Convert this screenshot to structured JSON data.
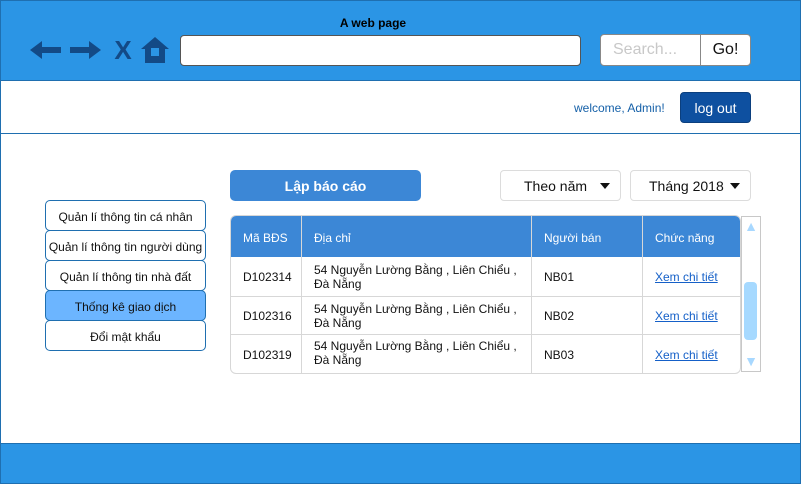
{
  "browser": {
    "title": "A web page",
    "url_value": "",
    "search_placeholder": "Search...",
    "go_label": "Go!",
    "close_label": "X"
  },
  "header": {
    "welcome": "welcome, Admin!",
    "logout_label": "log out"
  },
  "sidebar": {
    "items": [
      {
        "label": "Quản lí thông tin cá nhân"
      },
      {
        "label": "Quản lí thông tin người dùng"
      },
      {
        "label": "Quản lí thông tin nhà đất"
      },
      {
        "label": "Thống kê giao dịch",
        "active": true
      },
      {
        "label": "Đổi mật khẩu"
      }
    ]
  },
  "toolbar": {
    "report_label": "Lập báo cáo",
    "period_value": "Theo năm",
    "month_value": "Tháng 2018"
  },
  "table": {
    "headers": [
      "Mã BĐS",
      "Địa chỉ",
      "Người bán",
      "Chức năng"
    ],
    "rows": [
      {
        "id": "D102314",
        "address": "54 Nguyễn Lường Bằng , Liên Chiểu , Đà Nẵng",
        "seller": "NB01",
        "action": "Xem chi tiết"
      },
      {
        "id": "D102316",
        "address": "54 Nguyễn Lường Bằng , Liên Chiểu , Đà Nẵng",
        "seller": "NB02",
        "action": "Xem chi tiết"
      },
      {
        "id": "D102319",
        "address": "54 Nguyễn Lường Bằng , Liên Chiểu , Đà Nẵng",
        "seller": "NB03",
        "action": "Xem chi tiết"
      }
    ]
  },
  "icons": {
    "back": "arrow-left-icon",
    "forward": "arrow-right-icon",
    "close": "close-icon",
    "home": "home-icon"
  },
  "colors": {
    "chrome": "#2b95e5",
    "primary_button": "#3c87d6",
    "logout_button": "#0e50a0",
    "active_item": "#6cb5ff",
    "link": "#1560c8"
  }
}
